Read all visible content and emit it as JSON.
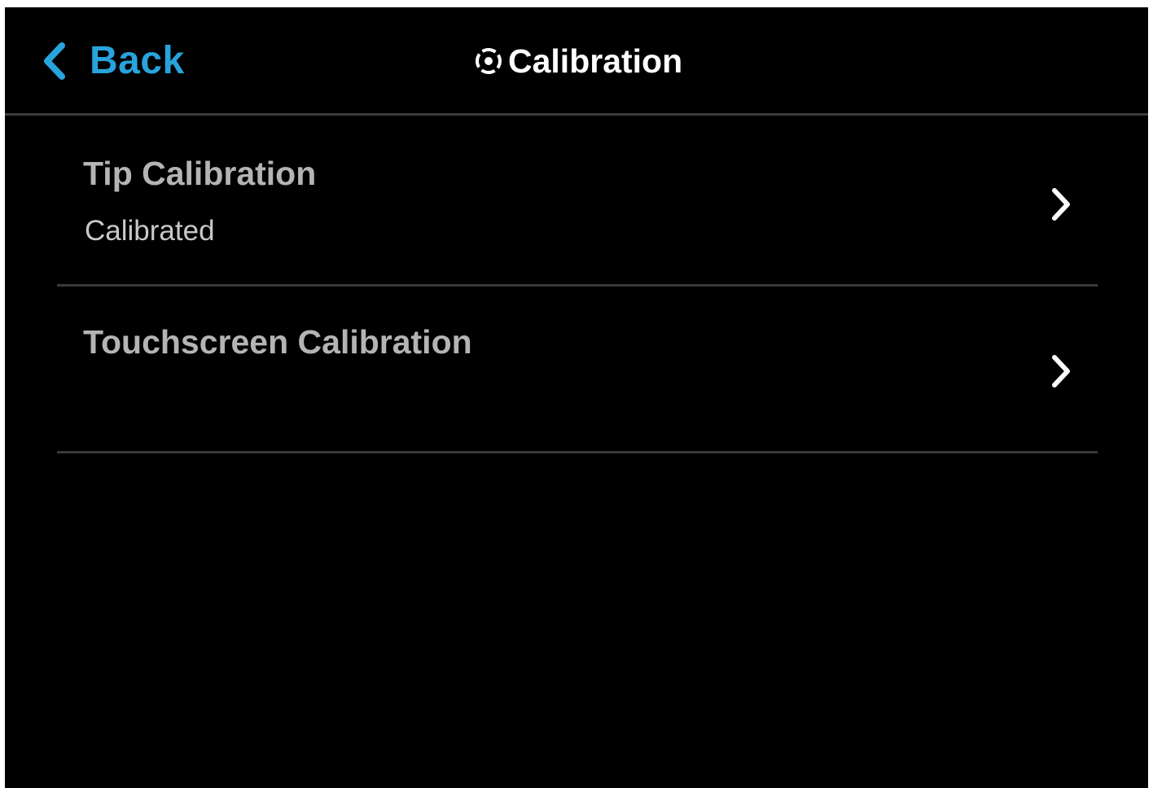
{
  "theme": {
    "accent": "#29a3dc",
    "background": "#000000",
    "divider": "#3a3a3a",
    "row_title_color": "#b4b4b4",
    "row_subtitle_color": "#c8c8c8",
    "header_title_color": "#ffffff"
  },
  "header": {
    "back_label": "Back",
    "back_icon": "chevron-left-icon",
    "title": "Calibration",
    "title_icon": "crosshair-target-icon"
  },
  "items": [
    {
      "title": "Tip Calibration",
      "subtitle": "Calibrated",
      "icon": "chevron-right-icon"
    },
    {
      "title": "Touchscreen Calibration",
      "subtitle": "",
      "icon": "chevron-right-icon"
    }
  ]
}
